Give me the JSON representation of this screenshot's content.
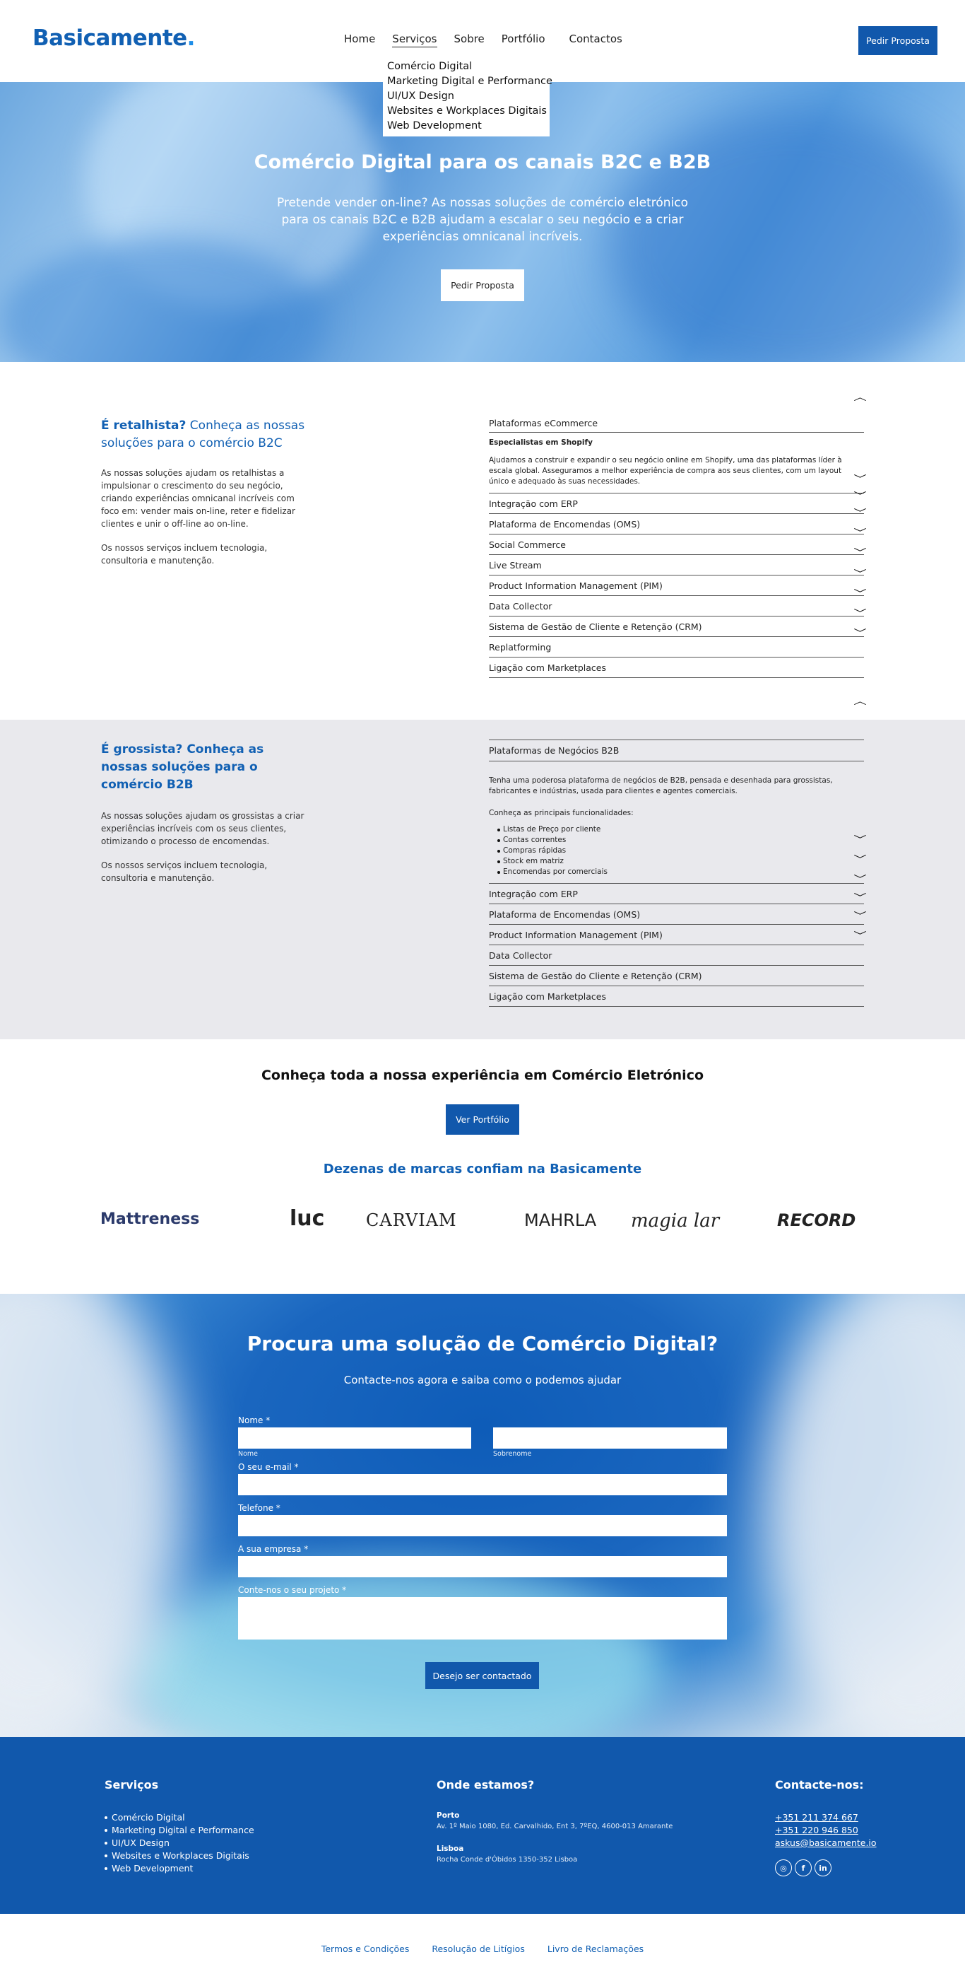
{
  "header": {
    "logo_text": "Basicamente",
    "logo_dot": ".",
    "nav": [
      "Home",
      "Serviços",
      "Sobre",
      "Portfólio",
      "Contactos"
    ],
    "cta": "Pedir Proposta",
    "dropdown": [
      "Comércio Digital",
      "Marketing Digital e Performance",
      "UI/UX Design",
      "Websites e Workplaces Digitais",
      "Web Development"
    ]
  },
  "hero": {
    "title": "Comércio Digital para os canais B2C e B2B",
    "text": "Pretende vender on-line? As nossas soluções de comércio eletrónico para os canais B2C e B2B ajudam a escalar o seu negócio e a criar experiências omnicanal incríveis.",
    "cta": "Pedir Proposta"
  },
  "b2c": {
    "title_bold": "É retalhista?",
    "title_rest": " Conheça as nossas soluções para o comércio B2C",
    "p1": "As nossas soluções ajudam os retalhistas a impulsionar o crescimento do seu negócio, criando experiências omnicanal incríveis com foco em: vender mais on-line, reter e fidelizar clientes e unir o off-line ao on-line.",
    "p2": "Os nossos serviços incluem tecnologia, consultoria e manutenção.",
    "open_item": "Plataformas eCommerce",
    "open_heading": "Especialistas em Shopify",
    "open_text": "Ajudamos a construir e expandir o seu negócio online em Shopify, uma das plataformas líder à escala global. Asseguramos a melhor experiência de compra aos seus clientes, com um layout único e adequado às suas necessidades.",
    "items": [
      "Integração com ERP",
      "Plataforma de Encomendas (OMS)",
      "Social Commerce",
      "Live Stream",
      "Product Information Management (PIM)",
      "Data Collector",
      "Sistema de Gestão de Cliente e Retenção (CRM)",
      "Replatforming",
      "Ligação com Marketplaces"
    ]
  },
  "b2b": {
    "title": "É grossista? Conheça as nossas soluções para o comércio B2B",
    "p1": "As nossas soluções ajudam os grossistas a criar experiências incríveis com os seus clientes, otimizando o processo de encomendas.",
    "p2": "Os nossos serviços incluem tecnologia, consultoria e manutenção.",
    "open_item": "Plataformas de Negócios B2B",
    "open_text": "Tenha uma poderosa plataforma de negócios de B2B, pensada e desenhada para grossistas, fabricantes e indústrias, usada para clientes e agentes comerciais.",
    "features_intro": "Conheça as principais funcionalidades:",
    "features": [
      "Listas de Preço por cliente",
      "Contas correntes",
      "Compras rápidas",
      "Stock em matriz",
      "Encomendas por comerciais"
    ],
    "items": [
      "Integração com ERP",
      "Plataforma de Encomendas (OMS)",
      "Product Information Management (PIM)",
      "Data Collector",
      "Sistema de Gestão do Cliente e Retenção (CRM)",
      "Ligação com Marketplaces"
    ]
  },
  "experience": {
    "title": "Conheça toda a nossa experiência em Comércio Eletrónico",
    "cta": "Ver Portfólio",
    "brands_title": "Dezenas de marcas confiam na Basicamente",
    "logos": [
      "Mattreness",
      "luc",
      "CARVIAM",
      "MAHRLA",
      "magia lar",
      "RECORD"
    ]
  },
  "contact": {
    "title": "Procura uma solução de Comércio Digital?",
    "subtitle": "Contacte-nos agora e saiba como o podemos ajudar",
    "name_label": "Nome *",
    "first_sub": "Nome",
    "last_sub": "Sobrenome",
    "email_label": "O seu e-mail *",
    "phone_label": "Telefone *",
    "company_label": "A sua empresa *",
    "project_label": "Conte-nos o seu projeto *",
    "submit": "Desejo ser contactado"
  },
  "footer": {
    "services_title": "Serviços",
    "services": [
      "Comércio Digital",
      "Marketing Digital e Performance",
      "UI/UX Design",
      "Websites e Workplaces Digitais",
      "Web Development"
    ],
    "where_title": "Onde estamos?",
    "porto_label": "Porto",
    "porto_addr": "Av. 1º Maio 1080, Ed. Carvalhido, Ent 3, 7ºEQ, 4600-013 Amarante",
    "lisboa_label": "Lisboa",
    "lisboa_addr": "Rocha Conde d'Óbidos 1350-352 Lisboa",
    "contact_title": "Contacte-nos:",
    "phone1": "+351 211 374 667",
    "phone2": "+351 220 946 850",
    "email": "askus@basicamente.io",
    "social": [
      "instagram-icon",
      "facebook-icon",
      "linkedin-icon"
    ]
  },
  "legal": [
    "Termos e Condições",
    "Resolução de Litígios",
    "Livro de Reclamações"
  ]
}
